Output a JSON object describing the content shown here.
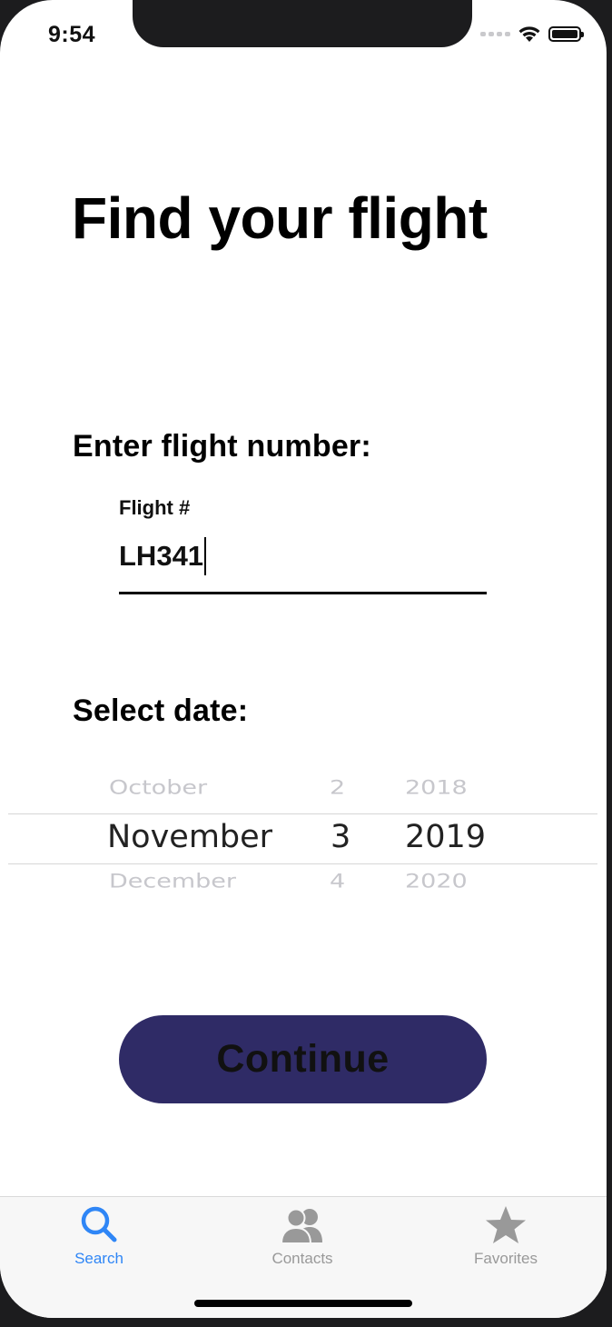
{
  "status_bar": {
    "time": "9:54"
  },
  "page": {
    "title": "Find your flight"
  },
  "flight_number": {
    "section_label": "Enter flight number:",
    "field_caption": "Flight #",
    "value": "LH341"
  },
  "date": {
    "section_label": "Select date:",
    "picker": {
      "previous": {
        "month": "October",
        "day": "2",
        "year": "2018"
      },
      "selected": {
        "month": "November",
        "day": "3",
        "year": "2019"
      },
      "next": {
        "month": "December",
        "day": "4",
        "year": "2020"
      }
    }
  },
  "actions": {
    "continue_label": "Continue"
  },
  "tab_bar": {
    "items": [
      {
        "label": "Search",
        "icon": "search-icon",
        "active": true
      },
      {
        "label": "Contacts",
        "icon": "contacts-icon",
        "active": false
      },
      {
        "label": "Favorites",
        "icon": "star-icon",
        "active": false
      }
    ]
  },
  "colors": {
    "primary_button": "#2f2b66",
    "tab_active": "#2f86f6",
    "tab_inactive": "#999999"
  }
}
